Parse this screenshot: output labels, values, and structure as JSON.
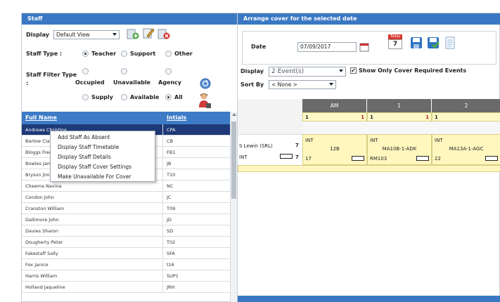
{
  "staff_panel": {
    "title": "Staff",
    "display_label": "Display",
    "display_value": "Default View",
    "staff_type_label": "Staff Type :",
    "staff_type_options": [
      "Teacher",
      "Support",
      "Other"
    ],
    "staff_type_selected": "Teacher",
    "filter_label": "Staff Filter Type",
    "filter_colon": ":",
    "filter_options_row1": [
      "Occupied",
      "Unavailable",
      "Agency"
    ],
    "filter_options_row2": [
      "Supply",
      "Available",
      "All"
    ],
    "filter_selected": "All",
    "icons": [
      "add-staff-icon",
      "edit-staff-icon",
      "delete-staff-icon",
      "refresh-icon",
      "person-icon"
    ]
  },
  "table": {
    "col_name": "Full Name",
    "col_initials": "Intials",
    "rows": [
      {
        "name": "Andrews Christine",
        "initials": "CPA"
      },
      {
        "name": "Barlow Clare",
        "initials": "CB"
      },
      {
        "name": "Bloggs Fred",
        "initials": "FB1"
      },
      {
        "name": "Bowles James",
        "initials": "JB"
      },
      {
        "name": "Bryson Jim",
        "initials": "T10"
      },
      {
        "name": "Cheema Navina",
        "initials": "NC"
      },
      {
        "name": "Condon John",
        "initials": "JC"
      },
      {
        "name": "Cranston William",
        "initials": "T09"
      },
      {
        "name": "Dallimore John",
        "initials": "JD"
      },
      {
        "name": "Davies Sharon",
        "initials": "SD"
      },
      {
        "name": "Dougherty Peter",
        "initials": "T02"
      },
      {
        "name": "Fakestaff Sally",
        "initials": "SFA"
      },
      {
        "name": "Fox Janice",
        "initials": "t16"
      },
      {
        "name": "Harris William",
        "initials": "SUP1"
      },
      {
        "name": "Holland Jaqueline",
        "initials": "JRH"
      }
    ]
  },
  "context_menu": [
    "Add Staff As Absent",
    "Display Staff Timetable",
    "Display Staff Details",
    "Display Staff Cover Settings",
    "Make Unavailable For Cover"
  ],
  "cover_panel": {
    "title": "Arrange cover for the selected date",
    "date_label": "Date",
    "date_value": "07/09/2017",
    "today_label": "Today",
    "today_num": "7",
    "display_label": "Display",
    "display_value": "2 Event(s)",
    "show_cover_label": "Show Only Cover Required Events",
    "sort_label": "Sort By",
    "sort_value": "< None >"
  },
  "grid": {
    "headers": [
      "AM",
      "1",
      "2"
    ],
    "sub_left": [
      "1",
      "1",
      "1"
    ],
    "sub_right": [
      "1",
      "1",
      ""
    ],
    "staff_name": "S Lewin (SRL)",
    "staff_count": "7",
    "staff_type": "INT",
    "staff_count2": "7",
    "cells": [
      {
        "top": "INT",
        "center": "12B",
        "bottom": "17"
      },
      {
        "top": "INT",
        "center": "MA10B-1-ADK",
        "bottom": "RM103"
      },
      {
        "top": "INT",
        "center": "MA13A-1-AGC",
        "bottom": "22"
      }
    ]
  },
  "colors": {
    "header_blue": "#3b78c3",
    "selected_row": "#1e3a78",
    "grid_header": "#6a6a6a",
    "event_yellow": "#fff7be"
  }
}
